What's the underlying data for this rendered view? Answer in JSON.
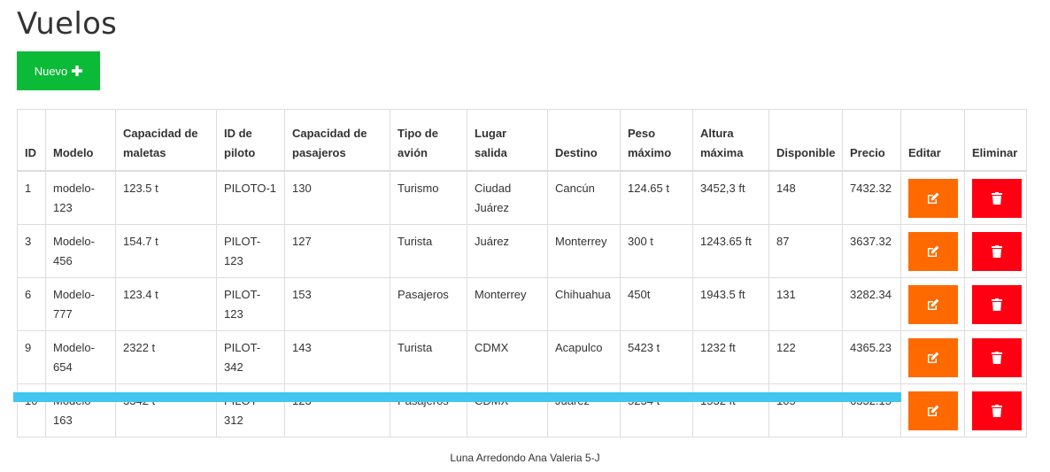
{
  "page": {
    "title": "Vuelos"
  },
  "toolbar": {
    "new_label": "Nuevo",
    "new_icon": "plus-icon",
    "new_color": "#0bbb37"
  },
  "table": {
    "headers": [
      "ID",
      "Modelo",
      "Capacidad de maletas",
      "ID de piloto",
      "Capacidad de pasajeros",
      "Tipo de avión",
      "Lugar salida",
      "Destino",
      "Peso máximo",
      "Altura máxima",
      "Disponible",
      "Precio",
      "Editar",
      "Eliminar"
    ],
    "rows": [
      {
        "id": "1",
        "modelo": "modelo-123",
        "maletas": "123.5 t",
        "piloto": "PILOTO-1",
        "pasajeros": "130",
        "tipo": "Turismo",
        "salida": "Ciudad Juárez",
        "destino": "Cancún",
        "peso": "124.65 t",
        "altura": "3452,3 ft",
        "disponible": "148",
        "precio": "7432.32"
      },
      {
        "id": "3",
        "modelo": "Modelo-456",
        "maletas": "154.7 t",
        "piloto": "PILOT-123",
        "pasajeros": "127",
        "tipo": "Turista",
        "salida": "Juárez",
        "destino": "Monterrey",
        "peso": "300 t",
        "altura": "1243.65 ft",
        "disponible": "87",
        "precio": "3637.32"
      },
      {
        "id": "6",
        "modelo": "Modelo-777",
        "maletas": "123.4 t",
        "piloto": "PILOT-123",
        "pasajeros": "153",
        "tipo": "Pasajeros",
        "salida": "Monterrey",
        "destino": "Chihuahua",
        "peso": "450t",
        "altura": "1943.5 ft",
        "disponible": "131",
        "precio": "3282.34"
      },
      {
        "id": "9",
        "modelo": "Modelo-654",
        "maletas": "2322 t",
        "piloto": "PILOT-342",
        "pasajeros": "143",
        "tipo": "Turista",
        "salida": "CDMX",
        "destino": "Acapulco",
        "peso": "5423 t",
        "altura": "1232 ft",
        "disponible": "122",
        "precio": "4365.23"
      },
      {
        "id": "10",
        "modelo": "Modelo-163",
        "maletas": "3342 t",
        "piloto": "PILOT-312",
        "pasajeros": "123",
        "tipo": "Pasajeros",
        "salida": "CDMX",
        "destino": "Juárez",
        "peso": "5234 t",
        "altura": "1532 ft",
        "disponible": "105",
        "precio": "6332.15"
      }
    ],
    "edit_icon": "edit-icon",
    "delete_icon": "trash-icon",
    "edit_color": "#ff6a00",
    "delete_color": "#ff0013"
  },
  "highlight": {
    "color": "#40c6f0"
  },
  "footer": {
    "text": "Luna Arredondo Ana Valeria 5-J"
  }
}
